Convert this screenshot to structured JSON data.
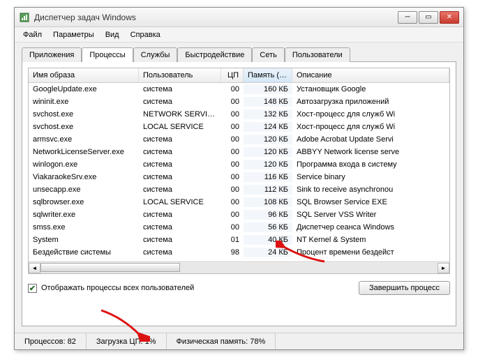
{
  "window": {
    "title": "Диспетчер задач Windows"
  },
  "menu": {
    "file": "Файл",
    "options": "Параметры",
    "view": "Вид",
    "help": "Справка"
  },
  "tabs": {
    "apps": "Приложения",
    "processes": "Процессы",
    "services": "Службы",
    "performance": "Быстродействие",
    "network": "Сеть",
    "users": "Пользователи"
  },
  "columns": {
    "image": "Имя образа",
    "user": "Пользователь",
    "cpu": "ЦП",
    "memory": "Память (ч...",
    "desc": "Описание"
  },
  "rows": [
    {
      "img": "GoogleUpdate.exe",
      "user": "система",
      "cpu": "00",
      "mem": "160 КБ",
      "desc": "Установщик Google"
    },
    {
      "img": "wininit.exe",
      "user": "система",
      "cpu": "00",
      "mem": "148 КБ",
      "desc": "Автозагрузка приложений"
    },
    {
      "img": "svchost.exe",
      "user": "NETWORK SERVICE",
      "cpu": "00",
      "mem": "132 КБ",
      "desc": "Хост-процесс для служб Wi"
    },
    {
      "img": "svchost.exe",
      "user": "LOCAL SERVICE",
      "cpu": "00",
      "mem": "124 КБ",
      "desc": "Хост-процесс для служб Wi"
    },
    {
      "img": "armsvc.exe",
      "user": "система",
      "cpu": "00",
      "mem": "120 КБ",
      "desc": "Adobe Acrobat Update Servi"
    },
    {
      "img": "NetworkLicenseServer.exe",
      "user": "система",
      "cpu": "00",
      "mem": "120 КБ",
      "desc": "ABBYY Network license serve"
    },
    {
      "img": "winlogon.exe",
      "user": "система",
      "cpu": "00",
      "mem": "120 КБ",
      "desc": "Программа входа в систему"
    },
    {
      "img": "ViakaraokeSrv.exe",
      "user": "система",
      "cpu": "00",
      "mem": "116 КБ",
      "desc": "Service binary"
    },
    {
      "img": "unsecapp.exe",
      "user": "система",
      "cpu": "00",
      "mem": "112 КБ",
      "desc": "Sink to receive asynchronou"
    },
    {
      "img": "sqlbrowser.exe",
      "user": "LOCAL SERVICE",
      "cpu": "00",
      "mem": "108 КБ",
      "desc": "SQL Browser Service EXE"
    },
    {
      "img": "sqlwriter.exe",
      "user": "система",
      "cpu": "00",
      "mem": "96 КБ",
      "desc": "SQL Server VSS Writer"
    },
    {
      "img": "smss.exe",
      "user": "система",
      "cpu": "00",
      "mem": "56 КБ",
      "desc": "Диспетчер сеанса  Windows"
    },
    {
      "img": "System",
      "user": "система",
      "cpu": "01",
      "mem": "40 КБ",
      "desc": "NT Kernel & System"
    },
    {
      "img": "Бездействие системы",
      "user": "система",
      "cpu": "98",
      "mem": "24 КБ",
      "desc": "Процент времени бездейст"
    }
  ],
  "checkbox": {
    "label": "Отображать процессы всех пользователей"
  },
  "buttons": {
    "end_process": "Завершить процесс"
  },
  "status": {
    "processes_label": "Процессов:",
    "processes_value": "82",
    "cpu_label": "Загрузка ЦП:",
    "cpu_value": "1%",
    "mem_label": "Физическая память:",
    "mem_value": "78%"
  }
}
